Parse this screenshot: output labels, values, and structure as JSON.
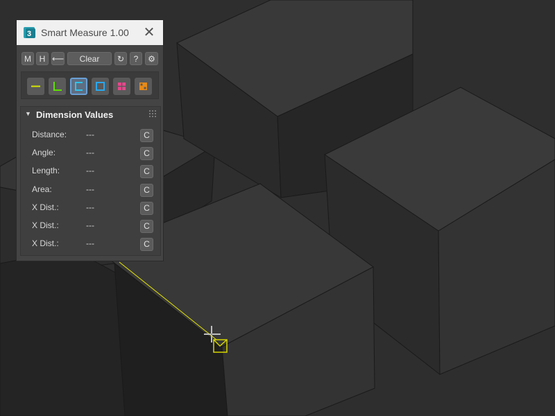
{
  "window": {
    "title": "Smart Measure 1.00",
    "close_label": "✕"
  },
  "toolbar": {
    "m_label": "M",
    "h_label": "H",
    "back_label": "⟵",
    "clear_label": "Clear",
    "refresh_label": "↻",
    "help_label": "?",
    "settings_label": "⚙"
  },
  "tools": [
    {
      "name": "line-tool",
      "color": "#d7e600"
    },
    {
      "name": "angle-tool",
      "color": "#5fe000"
    },
    {
      "name": "length-tool",
      "color": "#29c6ef",
      "active": true
    },
    {
      "name": "area-tool",
      "color": "#29a8ef"
    },
    {
      "name": "center-tool",
      "color": "#e8478c"
    },
    {
      "name": "grid-tool",
      "color": "#e88a18"
    }
  ],
  "dimension_values": {
    "title": "Dimension Values",
    "rows": [
      {
        "label": "Distance:",
        "value": "---",
        "btn": "C"
      },
      {
        "label": "Angle:",
        "value": "---",
        "btn": "C"
      },
      {
        "label": "Length:",
        "value": "---",
        "btn": "C"
      },
      {
        "label": "Area:",
        "value": "---",
        "btn": "C"
      },
      {
        "label": "X Dist.:",
        "value": "---",
        "btn": "C"
      },
      {
        "label": "X Dist.:",
        "value": "---",
        "btn": "C"
      },
      {
        "label": "X Dist.:",
        "value": "---",
        "btn": "C"
      }
    ]
  },
  "colors": {
    "measure_line": "#e6e600",
    "viewport_bg": "#2f2f2f"
  }
}
